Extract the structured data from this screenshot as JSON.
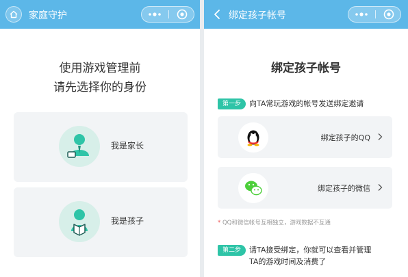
{
  "left_panel": {
    "window_title": "家庭守护",
    "heading_line1": "使用游戏管理前",
    "heading_line2": "请先选择你的身份",
    "roles": [
      {
        "label": "我是家长",
        "icon": "parent-avatar-icon"
      },
      {
        "label": "我是孩子",
        "icon": "child-avatar-icon"
      }
    ]
  },
  "right_panel": {
    "window_title": "绑定孩子帐号",
    "heading": "绑定孩子帐号",
    "step1": {
      "badge": "第一步",
      "text": "向TA常玩游戏的帐号发送绑定邀请"
    },
    "options": [
      {
        "label": "绑定孩子的QQ",
        "icon": "qq-penguin-icon"
      },
      {
        "label": "绑定孩子的微信",
        "icon": "wechat-icon"
      }
    ],
    "note_star": "*",
    "note": "QQ和微信帐号互相独立，游戏数据不互通",
    "step2": {
      "badge": "第二步",
      "line1": "请TA接受绑定，你就可以查看并管理",
      "line2": "TA的游戏时间及消费了"
    }
  },
  "colors": {
    "titlebar": "#5cb7e8",
    "accent_green": "#2ec4a7",
    "card_bg": "#f2f4f6",
    "avatar_bg": "#d7efe9"
  },
  "capsule": {
    "more_icon": "more-dots-icon",
    "close_icon": "record-circle-icon"
  }
}
